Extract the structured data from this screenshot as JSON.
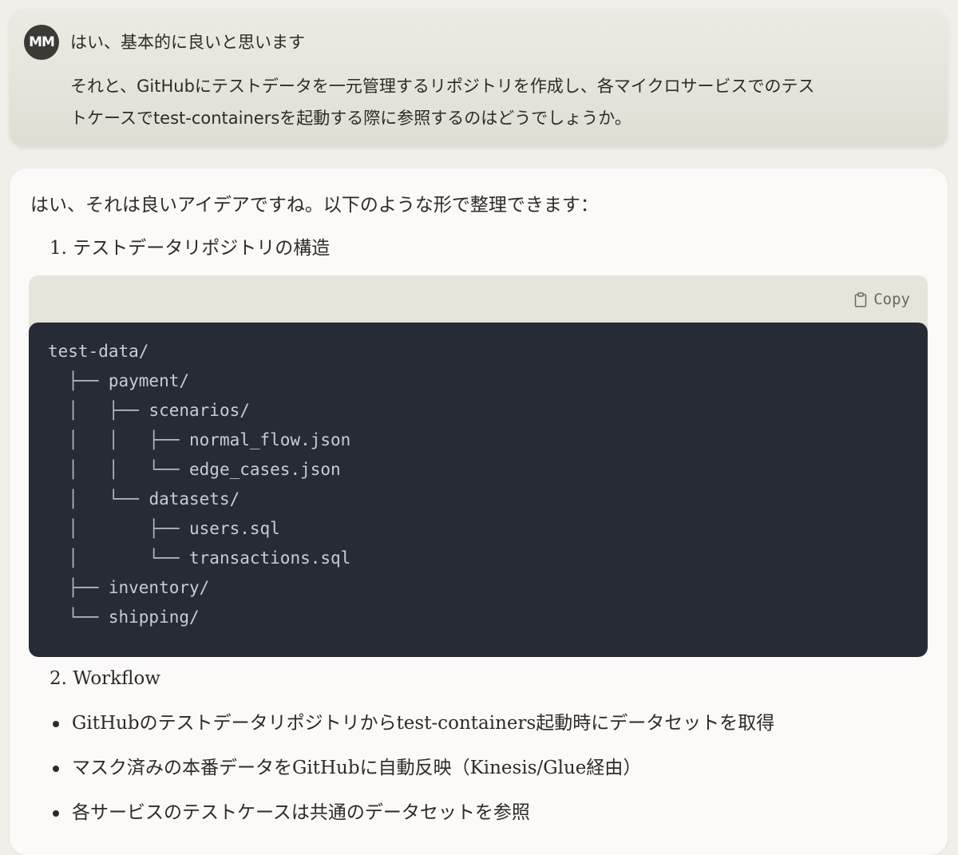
{
  "user_message": {
    "avatar_initials": "MM",
    "line1": "はい、基本的に良いと思います",
    "body_lines": [
      "それと、GitHubにテストデータを一元管理するリポジトリを作成し、各マイクロサービスでのテス",
      "トケースでtest-containersを起動する際に参照するのはどうでしょうか。"
    ]
  },
  "assistant_message": {
    "intro": "はい、それは良いアイデアですね。以下のような形で整理できます：",
    "section1_heading": "1. テストデータリポジトリの構造",
    "code_block": {
      "copy_label": "Copy",
      "copy_icon": "clipboard-icon",
      "lines": [
        {
          "guide": "",
          "text": "test-data/"
        },
        {
          "guide": "  ├── ",
          "text": "payment/"
        },
        {
          "guide": "  │   ├── ",
          "text": "scenarios/"
        },
        {
          "guide": "  │   │   ├── ",
          "text": "normal_flow.json"
        },
        {
          "guide": "  │   │   └── ",
          "text": "edge_cases.json"
        },
        {
          "guide": "  │   └── ",
          "text": "datasets/"
        },
        {
          "guide": "  │       ├── ",
          "text": "users.sql"
        },
        {
          "guide": "  │       └── ",
          "text": "transactions.sql"
        },
        {
          "guide": "  ├── ",
          "text": "inventory/"
        },
        {
          "guide": "  └── ",
          "text": "shipping/"
        }
      ]
    },
    "section2_heading": "2. Workflow",
    "bullets": [
      "GitHubのテストデータリポジトリからtest-containers起動時にデータセットを取得",
      "マスク済みの本番データをGitHubに自動反映（Kinesis/Glue経由）",
      "各サービスのテストケースは共通のデータセットを参照"
    ]
  },
  "colors": {
    "page_background": "#f0efe9",
    "user_bubble": "#e6e5dc",
    "assistant_bubble": "#fbfaf8",
    "code_header": "#e6e5da",
    "code_background": "#272b35",
    "code_text": "#c9ccd3",
    "avatar": "#3b3a35"
  }
}
